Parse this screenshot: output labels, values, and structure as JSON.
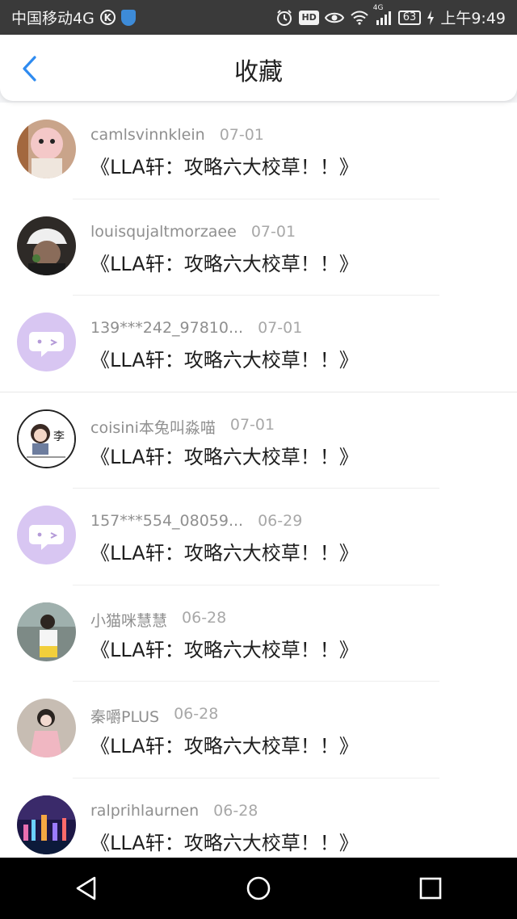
{
  "status_bar": {
    "carrier": "中国移动4G",
    "k_badge": "K",
    "hd_badge": "HD",
    "network_label": "4G",
    "battery": "63",
    "time": "上午9:49"
  },
  "header": {
    "title": "收藏",
    "back_icon": "chevron-left-icon"
  },
  "colors": {
    "accent": "#2f8bf0",
    "status_bar_bg": "#3a3a3a",
    "avatar_purple": "#d8c6f2",
    "text_gray": "#8f8f8f",
    "nav_bar_bg": "#000000"
  },
  "items": [
    {
      "username": "camlsvinnklein",
      "date": "07-01",
      "message": "《LLA轩：攻略六大校草！！》",
      "avatar": "photo-avatar"
    },
    {
      "username": "louisqujaltmorzaee",
      "date": "07-01",
      "message": "《LLA轩：攻略六大校草！！》",
      "avatar": "photo-avatar"
    },
    {
      "username": "139***242_97810...",
      "date": "07-01",
      "message": "《LLA轩：攻略六大校草！！》",
      "avatar": "default-chat-avatar"
    },
    {
      "username": "coisini本兔叫淼喵",
      "date": "07-01",
      "message": "《LLA轩：攻略六大校草！！》",
      "avatar": "photo-avatar"
    },
    {
      "username": "157***554_08059...",
      "date": "06-29",
      "message": "《LLA轩：攻略六大校草！！》",
      "avatar": "default-chat-avatar"
    },
    {
      "username": "小猫咪慧慧",
      "date": "06-28",
      "message": "《LLA轩：攻略六大校草！！》",
      "avatar": "photo-avatar"
    },
    {
      "username": "秦嚼PLUS",
      "date": "06-28",
      "message": "《LLA轩：攻略六大校草！！》",
      "avatar": "photo-avatar"
    },
    {
      "username": "ralprihlaurnen",
      "date": "06-28",
      "message": "《LLA轩：攻略六大校草！！》",
      "avatar": "photo-avatar"
    }
  ],
  "nav_bar": {
    "back": "triangle-back-icon",
    "home": "circle-home-icon",
    "recents": "square-recents-icon"
  }
}
